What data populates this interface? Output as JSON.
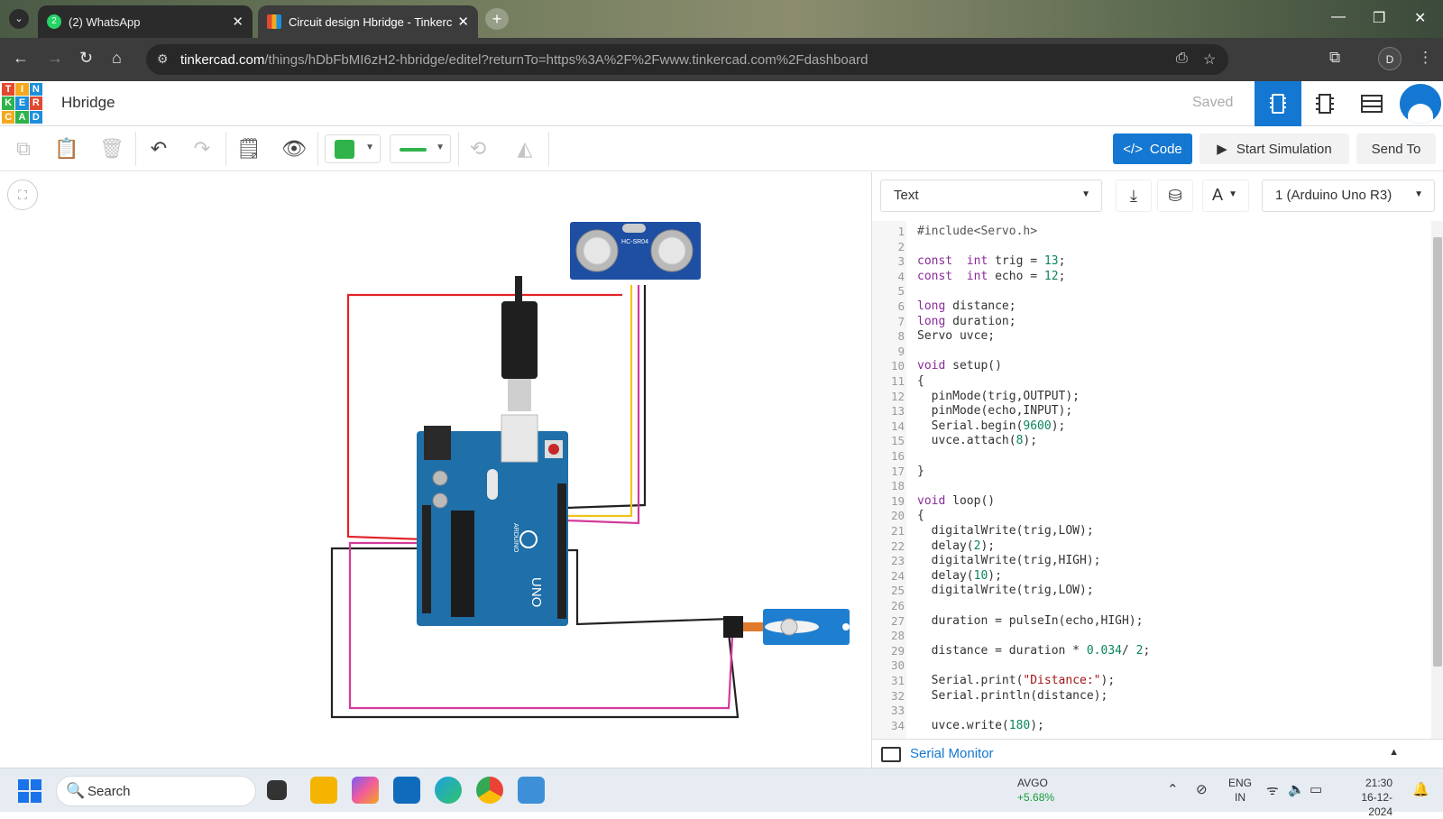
{
  "browser": {
    "tabs": [
      {
        "title": "(2) WhatsApp",
        "badge": "2"
      },
      {
        "title": "Circuit design Hbridge - Tinkerc"
      }
    ],
    "url_domain": "tinkercad.com",
    "url_rest": "/things/hDbFbMI6zH2-hbridge/editel?returnTo=https%3A%2F%2Fwww.tinkercad.com%2Fdashboard",
    "profile_initial": "D"
  },
  "app": {
    "logo_letters": [
      "T",
      "I",
      "N",
      "K",
      "E",
      "R",
      "C",
      "A",
      "D"
    ],
    "logo_colors": [
      "#e2492f",
      "#f4a81d",
      "#1d8fdb",
      "#2fb34a",
      "#1d8fdb",
      "#e2492f",
      "#f4a81d",
      "#2fb34a",
      "#1d8fdb"
    ],
    "project_title": "Hbridge",
    "save_status": "Saved"
  },
  "toolbar": {
    "fill_color": "#2fb34a",
    "code_label": "Code",
    "simulate_label": "Start Simulation",
    "send_label": "Send To"
  },
  "circuit": {
    "sensor_label": "HC-SR04",
    "board_label": "UNO",
    "board_brand": "ARDUINO"
  },
  "code_panel": {
    "mode": "Text",
    "board": "1 (Arduino Uno R3)",
    "serial_monitor_label": "Serial Monitor",
    "lines": [
      [
        [
          "pp",
          "#include<Servo.h>"
        ]
      ],
      [],
      [
        [
          "kw",
          "const"
        ],
        [
          "",
          "  "
        ],
        [
          "kw",
          "int"
        ],
        [
          "",
          " trig = "
        ],
        [
          "num",
          "13"
        ],
        [
          "",
          ";"
        ]
      ],
      [
        [
          "kw",
          "const"
        ],
        [
          "",
          "  "
        ],
        [
          "kw",
          "int"
        ],
        [
          "",
          " echo = "
        ],
        [
          "num",
          "12"
        ],
        [
          "",
          ";"
        ]
      ],
      [],
      [
        [
          "kw",
          "long"
        ],
        [
          "",
          " distance;"
        ]
      ],
      [
        [
          "kw",
          "long"
        ],
        [
          "",
          " duration;"
        ]
      ],
      [
        [
          "",
          "Servo uvce;"
        ]
      ],
      [],
      [
        [
          "kw",
          "void"
        ],
        [
          "",
          " setup()"
        ]
      ],
      [
        [
          "",
          "{"
        ]
      ],
      [
        [
          "",
          "  pinMode(trig,OUTPUT);"
        ]
      ],
      [
        [
          "",
          "  pinMode(echo,INPUT);"
        ]
      ],
      [
        [
          "",
          "  Serial.begin("
        ],
        [
          "num",
          "9600"
        ],
        [
          "",
          ");"
        ]
      ],
      [
        [
          "",
          "  uvce.attach("
        ],
        [
          "num",
          "8"
        ],
        [
          "",
          ");"
        ]
      ],
      [],
      [
        [
          "",
          "}"
        ]
      ],
      [],
      [
        [
          "kw",
          "void"
        ],
        [
          "",
          " loop()"
        ]
      ],
      [
        [
          "",
          "{"
        ]
      ],
      [
        [
          "",
          "  digitalWrite(trig,LOW);"
        ]
      ],
      [
        [
          "",
          "  delay("
        ],
        [
          "num",
          "2"
        ],
        [
          "",
          ");"
        ]
      ],
      [
        [
          "",
          "  digitalWrite(trig,HIGH);"
        ]
      ],
      [
        [
          "",
          "  delay("
        ],
        [
          "num",
          "10"
        ],
        [
          "",
          ");"
        ]
      ],
      [
        [
          "",
          "  digitalWrite(trig,LOW);"
        ]
      ],
      [],
      [
        [
          "",
          "  duration = pulseIn(echo,HIGH);"
        ]
      ],
      [],
      [
        [
          "",
          "  distance = duration * "
        ],
        [
          "num",
          "0.034"
        ],
        [
          "",
          "/ "
        ],
        [
          "num",
          "2"
        ],
        [
          "",
          ";"
        ]
      ],
      [],
      [
        [
          "",
          "  Serial.print("
        ],
        [
          "str",
          "\"Distance:\""
        ],
        [
          "",
          ");"
        ]
      ],
      [
        [
          "",
          "  Serial.println(distance);"
        ]
      ],
      [],
      [
        [
          "",
          "  uvce.write("
        ],
        [
          "num",
          "180"
        ],
        [
          "",
          ");"
        ]
      ]
    ]
  },
  "taskbar": {
    "search_placeholder": "Search",
    "stock_name": "AVGO",
    "stock_change": "+5.68%",
    "lang_top": "ENG",
    "lang_bottom": "IN",
    "time": "21:30",
    "date": "16-12-2024"
  }
}
